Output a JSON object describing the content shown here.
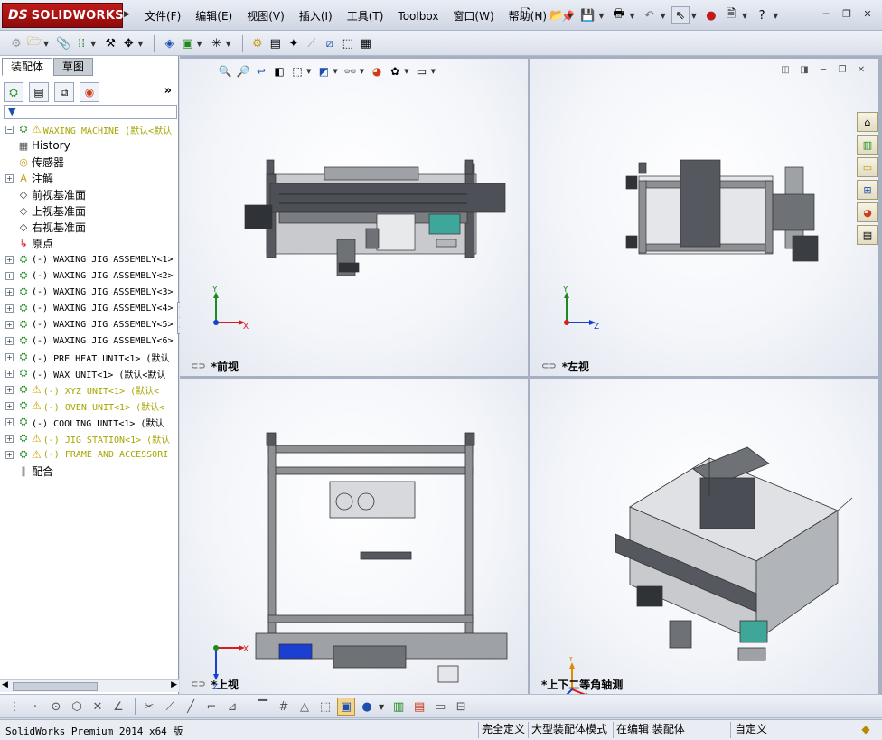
{
  "titlebar": {
    "logo_ds": "DS",
    "logo_text": "SOLIDWORKS",
    "menu": [
      "文件(F)",
      "编辑(E)",
      "视图(V)",
      "插入(I)",
      "工具(T)",
      "Toolbox",
      "窗口(W)",
      "帮助(H)"
    ]
  },
  "left_panel": {
    "tabs": [
      "装配体",
      "草图"
    ],
    "tree": [
      {
        "label": "WAXING MACHINE  (默认<默认",
        "icon": "assembly-icon",
        "warn": true,
        "exp": "−",
        "style": "yel mono"
      },
      {
        "label": "History",
        "icon": "history-icon",
        "exp": "",
        "style": ""
      },
      {
        "label": "传感器",
        "icon": "sensor-icon",
        "exp": "",
        "style": ""
      },
      {
        "label": "注解",
        "icon": "annotation-icon",
        "exp": "+",
        "style": ""
      },
      {
        "label": "前视基准面",
        "icon": "plane-icon",
        "exp": "",
        "style": ""
      },
      {
        "label": "上视基准面",
        "icon": "plane-icon",
        "exp": "",
        "style": ""
      },
      {
        "label": "右视基准面",
        "icon": "plane-icon",
        "exp": "",
        "style": ""
      },
      {
        "label": "原点",
        "icon": "origin-icon",
        "exp": "",
        "style": ""
      },
      {
        "label": "(-) WAXING JIG ASSEMBLY<1>",
        "icon": "subassembly-icon",
        "exp": "+",
        "style": "mono"
      },
      {
        "label": "(-) WAXING JIG ASSEMBLY<2>",
        "icon": "subassembly-icon",
        "exp": "+",
        "style": "mono"
      },
      {
        "label": "(-) WAXING JIG ASSEMBLY<3>",
        "icon": "subassembly-icon",
        "exp": "+",
        "style": "mono"
      },
      {
        "label": "(-) WAXING JIG ASSEMBLY<4>",
        "icon": "subassembly-icon",
        "exp": "+",
        "style": "mono"
      },
      {
        "label": "(-) WAXING JIG ASSEMBLY<5>",
        "icon": "subassembly-icon",
        "exp": "+",
        "style": "mono"
      },
      {
        "label": "(-) WAXING JIG ASSEMBLY<6>",
        "icon": "subassembly-icon",
        "exp": "+",
        "style": "mono"
      },
      {
        "label": "(-) PRE HEAT UNIT<1> (默认",
        "icon": "subassembly-icon",
        "exp": "+",
        "style": "mono"
      },
      {
        "label": "(-) WAX UNIT<1> (默认<默认",
        "icon": "subassembly-icon",
        "exp": "+",
        "style": "mono"
      },
      {
        "label": "(-) XYZ UNIT<1> (默认<",
        "icon": "subassembly-icon",
        "warn": true,
        "exp": "+",
        "style": "yel mono"
      },
      {
        "label": "(-) OVEN UNIT<1> (默认<",
        "icon": "subassembly-icon",
        "warn": true,
        "exp": "+",
        "style": "yel mono"
      },
      {
        "label": "(-) COOLING UNIT<1> (默认",
        "icon": "subassembly-icon",
        "exp": "+",
        "style": "mono"
      },
      {
        "label": "(-) JIG STATION<1> (默认",
        "icon": "subassembly-icon",
        "warn": true,
        "exp": "+",
        "style": "yel mono"
      },
      {
        "label": "(-) FRAME AND ACCESSORI",
        "icon": "subassembly-icon",
        "warn": true,
        "exp": "+",
        "style": "yel mono"
      },
      {
        "label": "配合",
        "icon": "mates-icon",
        "exp": "",
        "style": ""
      }
    ]
  },
  "viewports": {
    "front": {
      "label": "*前视"
    },
    "left": {
      "label": "*左视"
    },
    "top": {
      "label": "*上视"
    },
    "iso": {
      "label": "*上下二等角轴测"
    }
  },
  "triad": {
    "x": "X",
    "y": "Y",
    "z": "Z"
  },
  "statusbar": {
    "app": "SolidWorks Premium 2014 x64 版",
    "cells": [
      "完全定义",
      "大型装配体模式",
      "在编辑 装配体",
      "自定义"
    ]
  },
  "colors": {
    "brand": "#b31313",
    "warning": "#d8a000",
    "axis_x": "#d81b1b",
    "axis_y": "#1e8a1e",
    "axis_z": "#1b3fd0"
  }
}
